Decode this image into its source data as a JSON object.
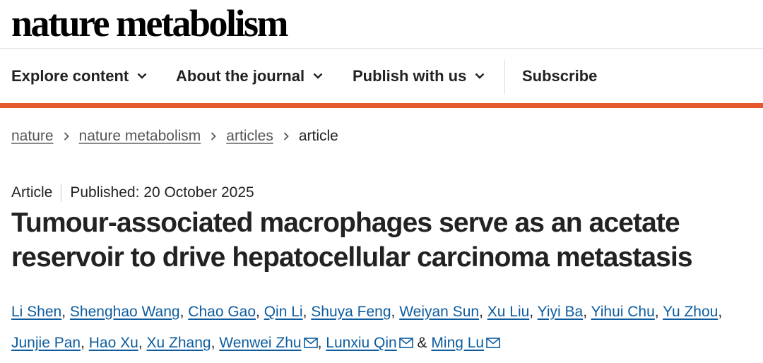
{
  "site": {
    "logo": "nature metabolism"
  },
  "nav": {
    "items": [
      {
        "label": "Explore content"
      },
      {
        "label": "About the journal"
      },
      {
        "label": "Publish with us"
      }
    ],
    "subscribe_label": "Subscribe"
  },
  "breadcrumb": {
    "items": [
      "nature",
      "nature metabolism",
      "articles"
    ],
    "current": "article"
  },
  "article": {
    "type": "Article",
    "published": "Published: 20 October 2025",
    "title": "Tumour-associated macrophages serve as an acetate reservoir to drive hepatocellular carcinoma metastasis",
    "authors": [
      "Li Shen",
      "Shenghao Wang",
      "Chao Gao",
      "Qin Li",
      "Shuya Feng",
      "Weiyan Sun",
      "Xu Liu",
      "Yiyi Ba",
      "Yihui Chu",
      "Yu Zhou",
      "Junjie Pan",
      "Hao Xu",
      "Xu Zhang",
      "Wenwei Zhu",
      "Lunxiu Qin",
      "Ming Lu"
    ],
    "separator": ",",
    "conjunction": "&"
  },
  "colors": {
    "accent": "#e6582d",
    "link": "#0c5c9e"
  }
}
